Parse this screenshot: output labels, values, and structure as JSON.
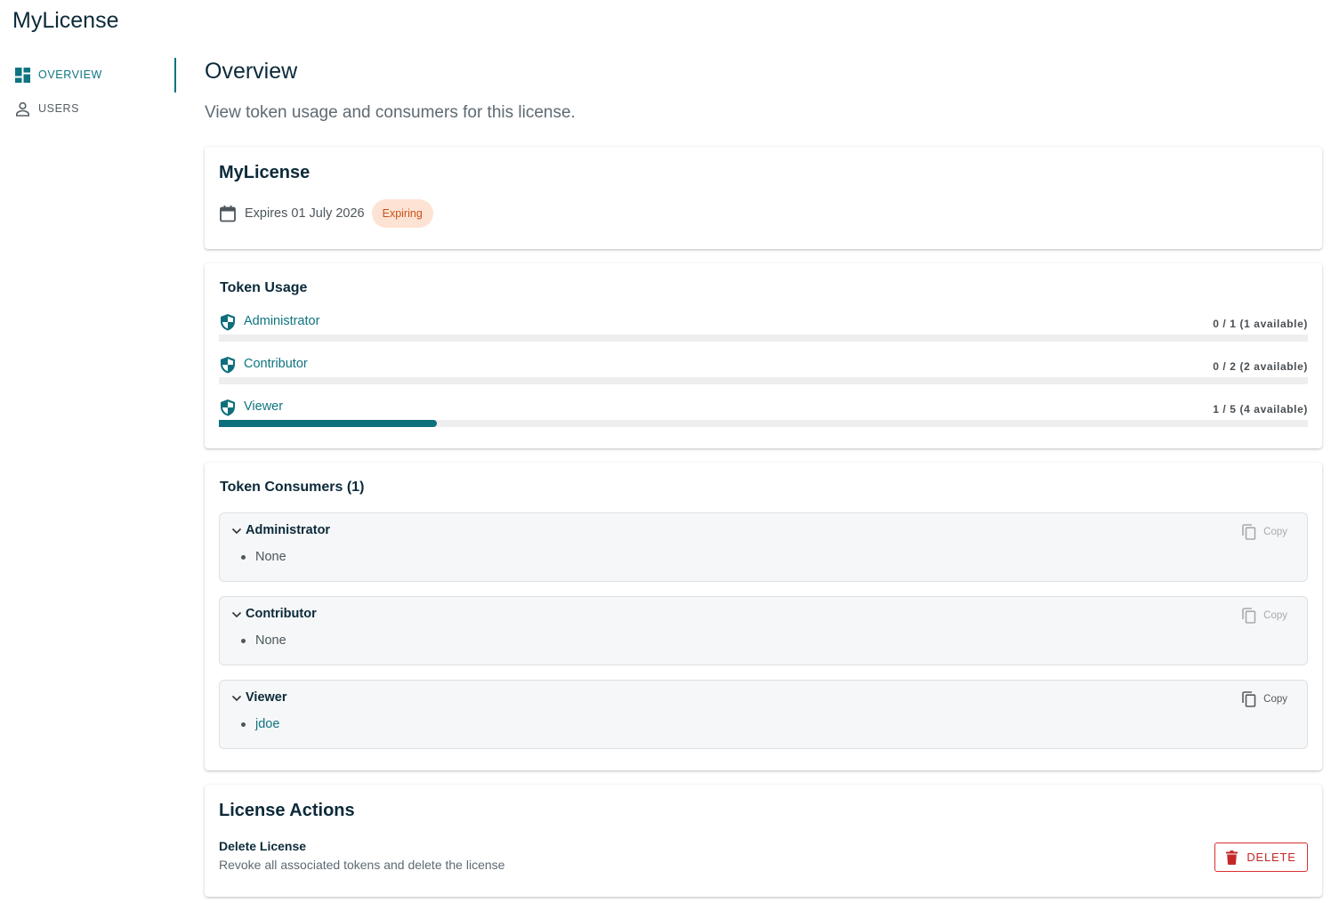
{
  "app": {
    "title": "MyLicense"
  },
  "sidebar": {
    "items": [
      {
        "label": "OVERVIEW",
        "icon": "dashboard-icon",
        "active": true
      },
      {
        "label": "USERS",
        "icon": "person-icon",
        "active": false
      }
    ]
  },
  "page": {
    "title": "Overview",
    "subtitle": "View token usage and consumers for this license."
  },
  "license": {
    "name": "MyLicense",
    "expires_text": "Expires 01 July 2026",
    "status_badge": "Expiring"
  },
  "token_usage": {
    "title": "Token Usage",
    "rows": [
      {
        "role": "Administrator",
        "count_text": "0 / 1 (1 available)",
        "used_fraction": 0.0
      },
      {
        "role": "Contributor",
        "count_text": "0 / 2 (2 available)",
        "used_fraction": 0.0
      },
      {
        "role": "Viewer",
        "count_text": "1 / 5 (4 available)",
        "used_fraction": 0.2
      }
    ]
  },
  "token_consumers": {
    "title": "Token Consumers (1)",
    "groups": [
      {
        "role": "Administrator",
        "copy_label": "Copy",
        "copy_enabled": false,
        "members": [
          "None"
        ],
        "members_are_links": false
      },
      {
        "role": "Contributor",
        "copy_label": "Copy",
        "copy_enabled": false,
        "members": [
          "None"
        ],
        "members_are_links": false
      },
      {
        "role": "Viewer",
        "copy_label": "Copy",
        "copy_enabled": true,
        "members": [
          "jdoe"
        ],
        "members_are_links": true
      }
    ]
  },
  "license_actions": {
    "title": "License Actions",
    "delete_label": "Delete License",
    "delete_description": "Revoke all associated tokens and delete the license",
    "delete_button": "DELETE"
  },
  "colors": {
    "primary": "#0e7480",
    "badge_bg": "#fde3d3",
    "badge_text": "#c8531b",
    "danger": "#c62828"
  }
}
